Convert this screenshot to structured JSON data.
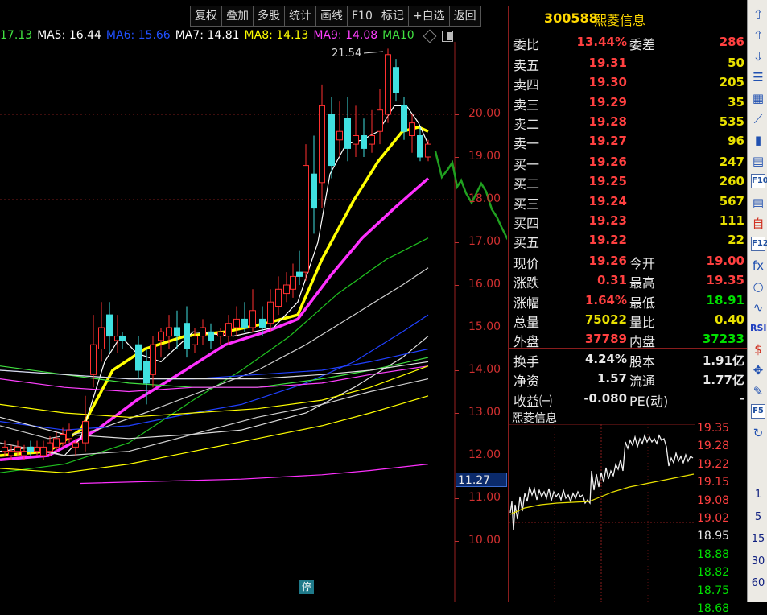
{
  "toolbar": {
    "buttons": [
      "复权",
      "叠加",
      "多股",
      "统计",
      "画线",
      "F10",
      "标记",
      "+自选",
      "返回"
    ]
  },
  "ma_legend": [
    {
      "label": "17.13",
      "color": "#40e040"
    },
    {
      "label": "MA5: 16.44",
      "color": "#ffffff"
    },
    {
      "label": "MA6: 15.66",
      "color": "#2050ff"
    },
    {
      "label": "MA7: 14.81",
      "color": "#ffffff"
    },
    {
      "label": "MA8: 14.13",
      "color": "#ffff00"
    },
    {
      "label": "MA9: 14.08",
      "color": "#ff40ff"
    },
    {
      "label": "MA10",
      "color": "#40e040"
    }
  ],
  "main_chart": {
    "high_marker": "21.54",
    "price_axis": [
      "20.00",
      "19.00",
      "18.00",
      "17.00",
      "16.00",
      "15.00",
      "14.00",
      "13.00",
      "12.00",
      "11.00",
      "10.00"
    ],
    "current_price_tag": "11.27",
    "stop_badge": "停"
  },
  "quote": {
    "code": "300588",
    "name": "熙菱信息",
    "weibi_label": "委比",
    "weibi": "13.44%",
    "weicha_label": "委差",
    "weicha": "286",
    "asks": [
      {
        "label": "卖五",
        "price": "19.31",
        "vol": "50"
      },
      {
        "label": "卖四",
        "price": "19.30",
        "vol": "205"
      },
      {
        "label": "卖三",
        "price": "19.29",
        "vol": "35"
      },
      {
        "label": "卖二",
        "price": "19.28",
        "vol": "535"
      },
      {
        "label": "卖一",
        "price": "19.27",
        "vol": "96"
      }
    ],
    "bids": [
      {
        "label": "买一",
        "price": "19.26",
        "vol": "247"
      },
      {
        "label": "买二",
        "price": "19.25",
        "vol": "260"
      },
      {
        "label": "买三",
        "price": "19.24",
        "vol": "567"
      },
      {
        "label": "买四",
        "price": "19.23",
        "vol": "111"
      },
      {
        "label": "买五",
        "price": "19.22",
        "vol": "22"
      }
    ],
    "stats": [
      {
        "l1": "现价",
        "v1": "19.26",
        "c1": "red",
        "l2": "今开",
        "v2": "19.00",
        "c2": "red"
      },
      {
        "l1": "涨跌",
        "v1": "0.31",
        "c1": "red",
        "l2": "最高",
        "v2": "19.35",
        "c2": "red"
      },
      {
        "l1": "涨幅",
        "v1": "1.64%",
        "c1": "red",
        "l2": "最低",
        "v2": "18.91",
        "c2": "grn"
      },
      {
        "l1": "总量",
        "v1": "75022",
        "c1": "yel",
        "l2": "量比",
        "v2": "0.40",
        "c2": "yel"
      },
      {
        "l1": "外盘",
        "v1": "37789",
        "c1": "red",
        "l2": "内盘",
        "v2": "37233",
        "c2": "grn"
      }
    ],
    "fin": [
      {
        "l1": "换手",
        "v1": "4.24%",
        "l2": "股本",
        "v2": "1.91亿"
      },
      {
        "l1": "净资",
        "v1": "1.57",
        "l2": "流通",
        "v2": "1.77亿"
      },
      {
        "l1": "收益㈠",
        "v1": "-0.080",
        "l2": "PE(动)",
        "v2": "-"
      }
    ],
    "mini_title": "熙菱信息",
    "mini_axis": [
      {
        "v": "19.35",
        "c": "red"
      },
      {
        "v": "19.28",
        "c": "red"
      },
      {
        "v": "19.22",
        "c": "red"
      },
      {
        "v": "19.15",
        "c": "red"
      },
      {
        "v": "19.08",
        "c": "red"
      },
      {
        "v": "19.02",
        "c": "red"
      },
      {
        "v": "18.95",
        "c": "wht"
      },
      {
        "v": "18.88",
        "c": "grn"
      },
      {
        "v": "18.82",
        "c": "grn"
      },
      {
        "v": "18.75",
        "c": "grn"
      },
      {
        "v": "18.68",
        "c": "grn"
      }
    ]
  },
  "sidebar": {
    "items": [
      "up-arrow-icon",
      "up-outline-icon",
      "down-outline-icon",
      "list-icon",
      "grid-icon",
      "line-chart-icon",
      "kline-icon",
      "window-icon",
      "F10",
      "doc-icon",
      "self-icon",
      "F12",
      "fx",
      "circle-icon",
      "wave-icon",
      "RSI",
      "dollar-icon",
      "move-icon",
      "pencil-icon",
      "F5",
      "refresh-icon"
    ],
    "periods": [
      "1",
      "5",
      "15",
      "30",
      "60"
    ]
  }
}
